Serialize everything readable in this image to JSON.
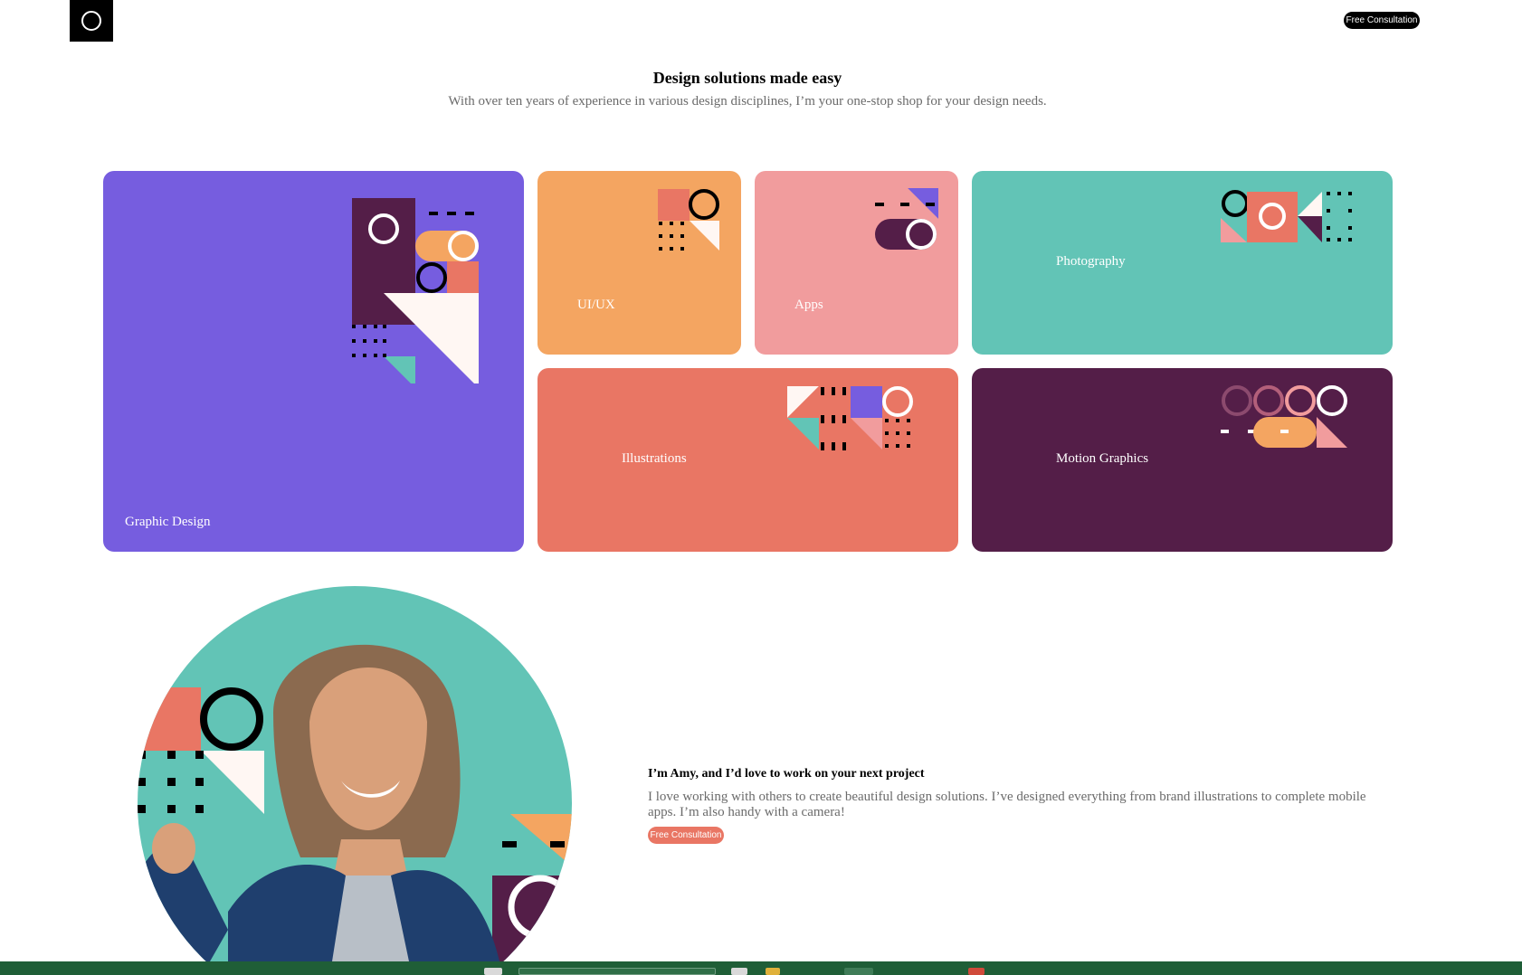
{
  "header": {
    "cta_label": "Free Consultation"
  },
  "hero": {
    "title": "Design solutions made easy",
    "subtitle": "With over ten years of experience in various design disciplines, I’m your one-stop shop for your design needs."
  },
  "services": [
    {
      "label": "Graphic Design",
      "color": "#765ddf"
    },
    {
      "label": "UI/UX",
      "color": "#f4a561"
    },
    {
      "label": "Apps",
      "color": "#f19c9d"
    },
    {
      "label": "Photography",
      "color": "#62c4b6"
    },
    {
      "label": "Illustrations",
      "color": "#e97664"
    },
    {
      "label": "Motion Graphics",
      "color": "#541e48"
    }
  ],
  "about": {
    "title": "I’m Amy, and I’d love to work on your next project",
    "text": "I love working with others to create beautiful design solutions. I’ve designed everything from brand illustrations to complete mobile apps. I’m also handy with a camera!",
    "cta_label": "Free Consultation"
  },
  "colors": {
    "purple": "#765ddf",
    "orange": "#f4a561",
    "pink": "#f19c9d",
    "teal": "#62c4b6",
    "coral": "#e97664",
    "plum": "#541e48",
    "cream": "#fff7f3"
  }
}
